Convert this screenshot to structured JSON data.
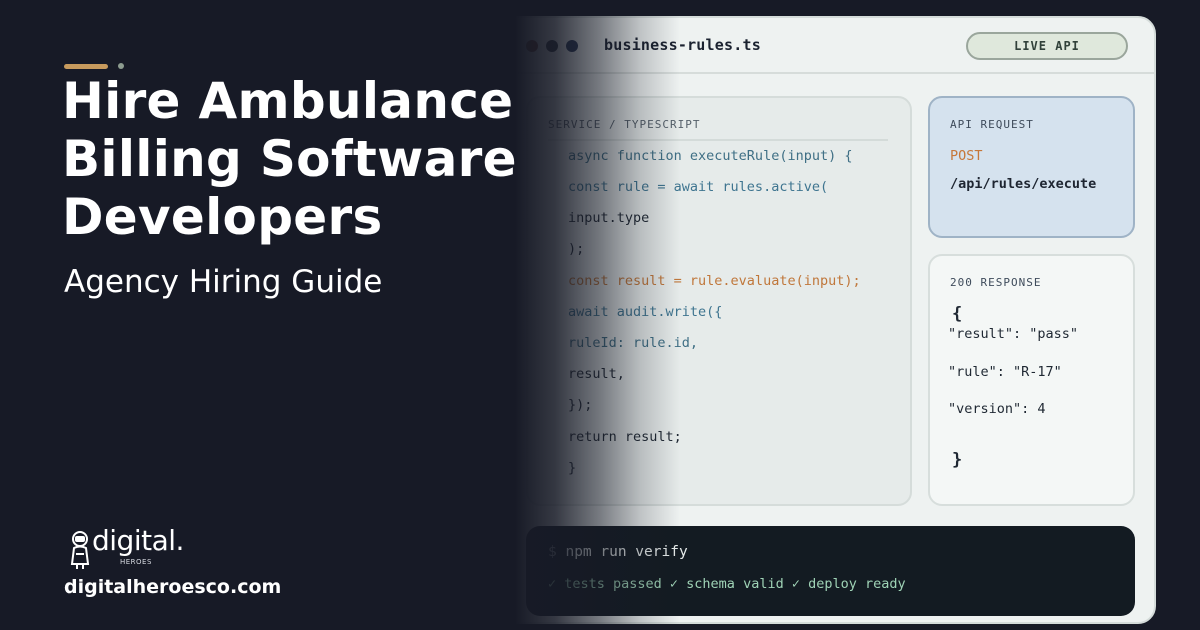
{
  "headline": {
    "line1": "Hire Ambulance",
    "line2": "Billing Software",
    "line3": "Developers"
  },
  "subheadline": "Agency Hiring Guide",
  "brand": {
    "logo_text": "digital.",
    "logo_subtext": "HEROES",
    "url": "digitalheroesco.com"
  },
  "editor": {
    "filename": "business-rules.ts",
    "status_pill": "LIVE API",
    "code_label": "SERVICE / TYPESCRIPT",
    "code_lines": [
      "async function executeRule(input) {",
      "const rule = await rules.active(",
      "input.type",
      ");",
      "const result = rule.evaluate(input);",
      "await audit.write({",
      "ruleId: rule.id,",
      "result,",
      "});",
      "return result;",
      "}"
    ],
    "request": {
      "label": "API REQUEST",
      "method": "POST",
      "path": "/api/rules/execute"
    },
    "response": {
      "label": "200 RESPONSE",
      "open_brace": "{",
      "lines": [
        "\"result\": \"pass\"",
        "\"rule\": \"R-17\"",
        "\"version\": 4"
      ],
      "close_brace": "}"
    },
    "terminal": {
      "prompt": "$",
      "command": "npm run verify",
      "output": "✓ tests passed ✓ schema valid ✓ deploy ready"
    }
  },
  "colors": {
    "background": "#171a26",
    "accent": "#c79a5d",
    "keyword": "#3f6f85",
    "orange": "#c0773b",
    "terminal_green": "#9fd3b6"
  }
}
